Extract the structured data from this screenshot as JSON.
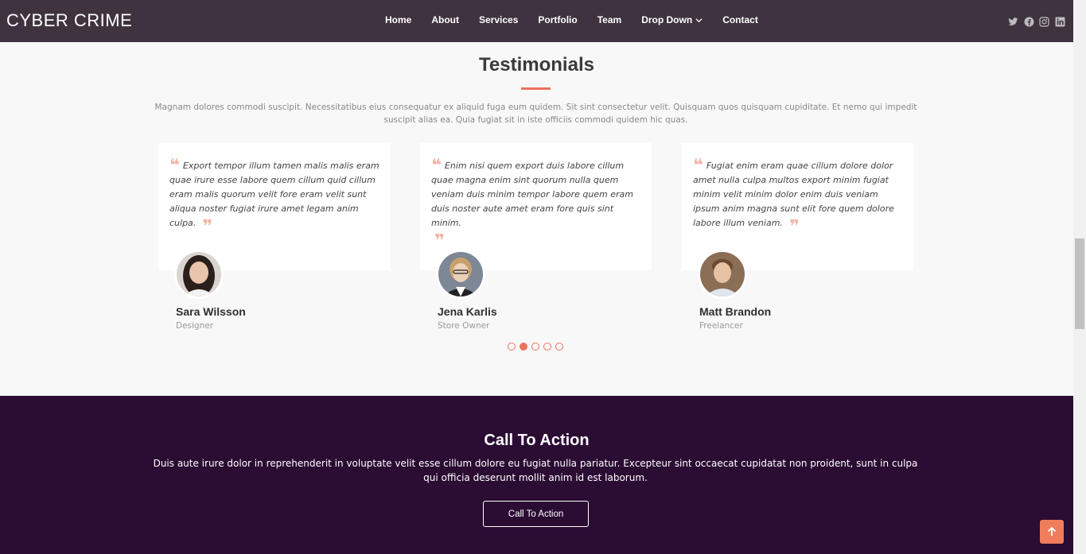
{
  "header": {
    "logo": "CYBER CRIME",
    "nav": [
      "Home",
      "About",
      "Services",
      "Portfolio",
      "Team",
      "Drop Down",
      "Contact"
    ],
    "social_icons": [
      "twitter-icon",
      "facebook-icon",
      "instagram-icon",
      "linkedin-icon"
    ]
  },
  "testimonials": {
    "title": "Testimonials",
    "intro": "Magnam dolores commodi suscipit. Necessitatibus eius consequatur ex aliquid fuga eum quidem. Sit sint consectetur velit. Quisquam quos quisquam cupiditate. Et nemo qui impedit suscipit alias ea. Quia fugiat sit in iste officiis commodi quidem hic quas.",
    "items": [
      {
        "quote": "Export tempor illum tamen malis malis eram quae irure esse labore quem cillum quid cillum eram malis quorum velit fore eram velit sunt aliqua noster fugiat irure amet legam anim culpa.",
        "name": "Sara Wilsson",
        "role": "Designer"
      },
      {
        "quote": "Enim nisi quem export duis labore cillum quae magna enim sint quorum nulla quem veniam duis minim tempor labore quem eram duis noster aute amet eram fore quis sint minim.",
        "name": "Jena Karlis",
        "role": "Store Owner"
      },
      {
        "quote": "Fugiat enim eram quae cillum dolore dolor amet nulla culpa multos export minim fugiat minim velit minim dolor enim duis veniam ipsum anim magna sunt elit fore quem dolore labore illum veniam.",
        "name": "Matt Brandon",
        "role": "Freelancer"
      }
    ],
    "active_page": 2,
    "page_count": 5
  },
  "cta": {
    "title": "Call To Action",
    "text": "Duis aute irure dolor in reprehenderit in voluptate velit esse cillum dolore eu fugiat nulla pariatur. Excepteur sint occaecat cupidatat non proident, sunt in culpa qui officia deserunt mollit anim id est laborum.",
    "button": "Call To Action"
  },
  "colors": {
    "header_bg": "#3f3340",
    "accent": "#e9735c",
    "cta_bg": "#2b0c33"
  }
}
